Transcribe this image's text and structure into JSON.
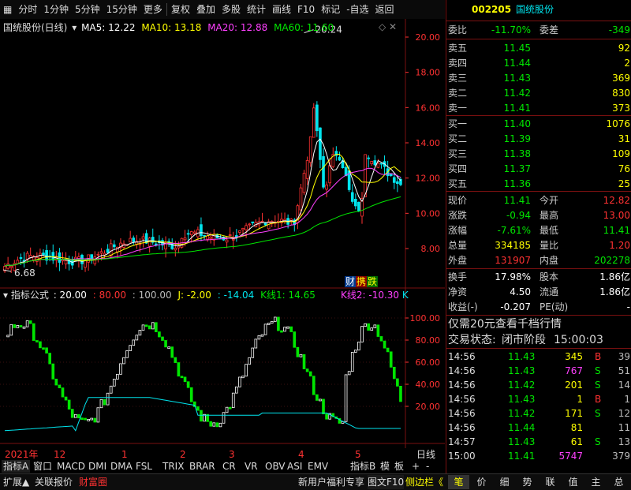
{
  "toolbar": {
    "items": [
      "分时",
      "1分钟",
      "5分钟",
      "15分钟",
      "更多",
      "复权",
      "叠加",
      "多股",
      "统计",
      "画线",
      "F10",
      "标记",
      "-自选",
      "返回"
    ]
  },
  "main_chart": {
    "title": "国统股份(日线)",
    "ma": [
      {
        "label": "MA5: 12.22",
        "color": "#ffffff"
      },
      {
        "label": "MA10: 13.18",
        "color": "#ffff00"
      },
      {
        "label": "MA20: 12.88",
        "color": "#ff40ff"
      },
      {
        "label": "MA60: 11.60",
        "color": "#00e600"
      }
    ],
    "high_label": "20.24",
    "low_label": "6.68",
    "price_ticks": [
      "20.00",
      "18.00",
      "16.00",
      "14.00",
      "12.00",
      "10.00",
      "8.00"
    ],
    "badges": [
      "财",
      "携",
      "跌"
    ]
  },
  "indicator": {
    "title": "指标公式",
    "params": [
      {
        "text": ": 20.00",
        "color": "#ffffff"
      },
      {
        "text": ": 80.00",
        "color": "#ff3232"
      },
      {
        "text": ": 100.00",
        "color": "#bbbbbb"
      },
      {
        "text": "J: -2.00",
        "color": "#ffff00"
      },
      {
        "text": ": -14.04",
        "color": "#00e5ee"
      },
      {
        "text": "K线1: 14.65",
        "color": "#00e600"
      },
      {
        "text": "K线2: -10.30",
        "color": "#ff40ff"
      }
    ],
    "ticks": [
      "100.00",
      "80.00",
      "60.00",
      "40.00",
      "20.00"
    ]
  },
  "date_axis": {
    "labels": [
      "2021年",
      "12",
      "1",
      "2",
      "3",
      "4",
      "5"
    ],
    "right_label": "日线"
  },
  "bottom_tabs": [
    "指标A",
    "窗口",
    "MACD",
    "DMI",
    "DMA",
    "FSL",
    "TRIX",
    "BRAR",
    "CR",
    "VR",
    "OBV",
    "ASI",
    "EMV",
    "指标B",
    "模",
    "板"
  ],
  "status_bar": {
    "left": [
      "扩展▲",
      "关联报价",
      "财富圈"
    ],
    "promo": "新用户福利专享",
    "f10": "图文F10",
    "side": "侧边栏《",
    "right_tabs": [
      "笔",
      "价",
      "细",
      "势",
      "联",
      "值",
      "主",
      "总"
    ]
  },
  "quote": {
    "code": "002205",
    "name": "国统股份",
    "weibi_label": "委比",
    "weibi": "-11.70%",
    "weicha_label": "委差",
    "weicha": "-349",
    "asks": [
      {
        "label": "卖五",
        "price": "11.45",
        "vol": "92"
      },
      {
        "label": "卖四",
        "price": "11.44",
        "vol": "2"
      },
      {
        "label": "卖三",
        "price": "11.43",
        "vol": "369"
      },
      {
        "label": "卖二",
        "price": "11.42",
        "vol": "830"
      },
      {
        "label": "卖一",
        "price": "11.41",
        "vol": "373"
      }
    ],
    "bids": [
      {
        "label": "买一",
        "price": "11.40",
        "vol": "1076"
      },
      {
        "label": "买二",
        "price": "11.39",
        "vol": "31"
      },
      {
        "label": "买三",
        "price": "11.38",
        "vol": "109"
      },
      {
        "label": "买四",
        "price": "11.37",
        "vol": "76"
      },
      {
        "label": "买五",
        "price": "11.36",
        "vol": "25"
      }
    ],
    "stats": [
      {
        "l1": "现价",
        "v1": "11.41",
        "c1": "green",
        "l2": "今开",
        "v2": "12.82",
        "c2": "red"
      },
      {
        "l1": "涨跌",
        "v1": "-0.94",
        "c1": "green",
        "l2": "最高",
        "v2": "13.00",
        "c2": "red"
      },
      {
        "l1": "涨幅",
        "v1": "-7.61%",
        "c1": "green",
        "l2": "最低",
        "v2": "11.41",
        "c2": "green"
      },
      {
        "l1": "总量",
        "v1": "334185",
        "c1": "yellow",
        "l2": "量比",
        "v2": "1.20",
        "c2": "red"
      },
      {
        "l1": "外盘",
        "v1": "131907",
        "c1": "red",
        "l2": "内盘",
        "v2": "202278",
        "c2": "green"
      }
    ],
    "stats2": [
      {
        "l1": "换手",
        "v1": "17.98%",
        "l2": "股本",
        "v2": "1.86亿"
      },
      {
        "l1": "净资",
        "v1": "4.50",
        "l2": "流通",
        "v2": "1.86亿"
      },
      {
        "l1": "收益(-)",
        "v1": "-0.207",
        "l2": "PE(动)",
        "v2": "-"
      }
    ],
    "promo": "仅需20元查看千档行情",
    "trade_status_label": "交易状态:",
    "trade_status": "闭市阶段",
    "trade_time": "15:00:03",
    "ticks": [
      {
        "t": "14:56",
        "p": "11.43",
        "v": "345",
        "vc": "yellow",
        "bs": "B",
        "n": "39"
      },
      {
        "t": "14:56",
        "p": "11.43",
        "v": "767",
        "vc": "mag",
        "bs": "S",
        "n": "51"
      },
      {
        "t": "14:56",
        "p": "11.42",
        "v": "201",
        "vc": "yellow",
        "bs": "S",
        "n": "14"
      },
      {
        "t": "14:56",
        "p": "11.43",
        "v": "1",
        "vc": "yellow",
        "bs": "B",
        "n": "1"
      },
      {
        "t": "14:56",
        "p": "11.42",
        "v": "171",
        "vc": "yellow",
        "bs": "S",
        "n": "12"
      },
      {
        "t": "14:56",
        "p": "11.44",
        "v": "81",
        "vc": "yellow",
        "bs": "",
        "n": "11"
      },
      {
        "t": "14:57",
        "p": "11.43",
        "v": "61",
        "vc": "yellow",
        "bs": "S",
        "n": "13"
      },
      {
        "t": "15:00",
        "p": "11.41",
        "v": "5747",
        "vc": "mag",
        "bs": "",
        "n": "379"
      }
    ]
  },
  "colors": {
    "up": "#ff3232",
    "down": "#00e600",
    "grid": "#7a1010",
    "accent": "#00e5ee"
  }
}
